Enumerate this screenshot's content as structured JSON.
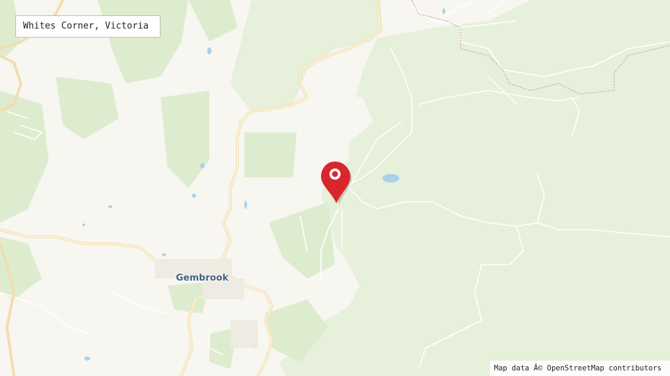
{
  "map": {
    "title": "Whites Corner, Victoria",
    "place_labels": {
      "gembrook": "Gembrook"
    },
    "attribution": "Map data Â© OpenStreetMap contributors",
    "marker": {
      "icon": "map-pin-icon",
      "color": "#d9262c"
    },
    "colors": {
      "land": "#f8f6f1",
      "forest": "#e6f0db",
      "park": "#ddeccf",
      "water": "#a9d1e8",
      "road": "#fbe8b6",
      "track": "#ffffff"
    }
  }
}
